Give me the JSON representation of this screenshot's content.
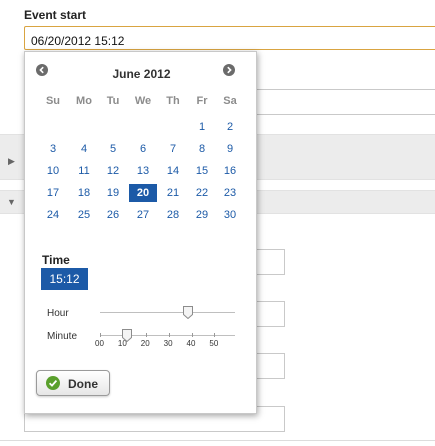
{
  "form": {
    "field_label": "Event start",
    "field_value": "06/20/2012 15:12"
  },
  "calendar": {
    "month_title": "June 2012",
    "prev_icon": "chevron-left-circle-icon",
    "next_icon": "chevron-right-circle-icon",
    "weekdays": [
      "Su",
      "Mo",
      "Tu",
      "We",
      "Th",
      "Fr",
      "Sa"
    ],
    "weeks": [
      [
        "",
        "",
        "",
        "",
        "",
        "1",
        "2"
      ],
      [
        "3",
        "4",
        "5",
        "6",
        "7",
        "8",
        "9"
      ],
      [
        "10",
        "11",
        "12",
        "13",
        "14",
        "15",
        "16"
      ],
      [
        "17",
        "18",
        "19",
        "20",
        "21",
        "22",
        "23"
      ],
      [
        "24",
        "25",
        "26",
        "27",
        "28",
        "29",
        "30"
      ]
    ],
    "selected_day": "20",
    "accent_color": "#1c5aa7"
  },
  "time": {
    "label": "Time",
    "value": "15:12",
    "hour_label": "Hour",
    "minute_label": "Minute",
    "hour_value": 15,
    "hour_max": 23,
    "minute_value": 12,
    "minute_max": 59,
    "minute_ticks": [
      "00",
      "10",
      "20",
      "30",
      "40",
      "50"
    ]
  },
  "done": {
    "label": "Done",
    "icon": "check-circle-icon"
  }
}
